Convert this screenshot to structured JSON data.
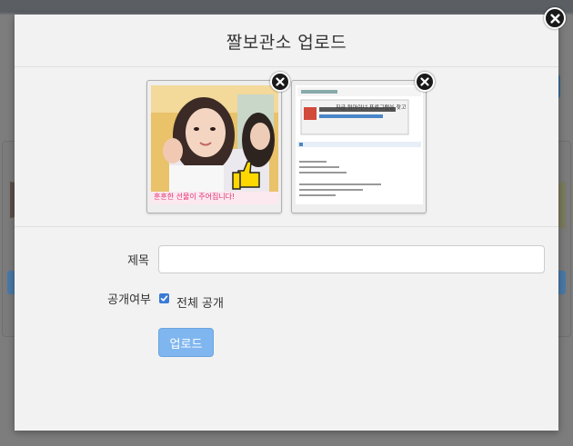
{
  "modal": {
    "title": "짤보관소 업로드",
    "close_icon": "close-circle-icon"
  },
  "thumbnails": [
    {
      "description_icon": "photo-thumbnail",
      "remove_icon": "close-circle-icon",
      "caption": "훈훈한 선물이 주어집니다!"
    },
    {
      "description_icon": "screenshot-thumbnail",
      "remove_icon": "close-circle-icon",
      "banner_text": "지금 뒤아이너 프로그램을 찾고 계시나요?"
    }
  ],
  "form": {
    "title_label": "제목",
    "title_value": "",
    "title_placeholder": "",
    "visibility_label": "공개여부",
    "public_checkbox_label": "전체 공개",
    "public_checked": true,
    "upload_button": "업로드"
  },
  "colors": {
    "accent": "#3a7bd5",
    "upload_button": "#7fb6ef",
    "backdrop": "#7d7d7d",
    "modal_bg": "#f2f2f2"
  }
}
